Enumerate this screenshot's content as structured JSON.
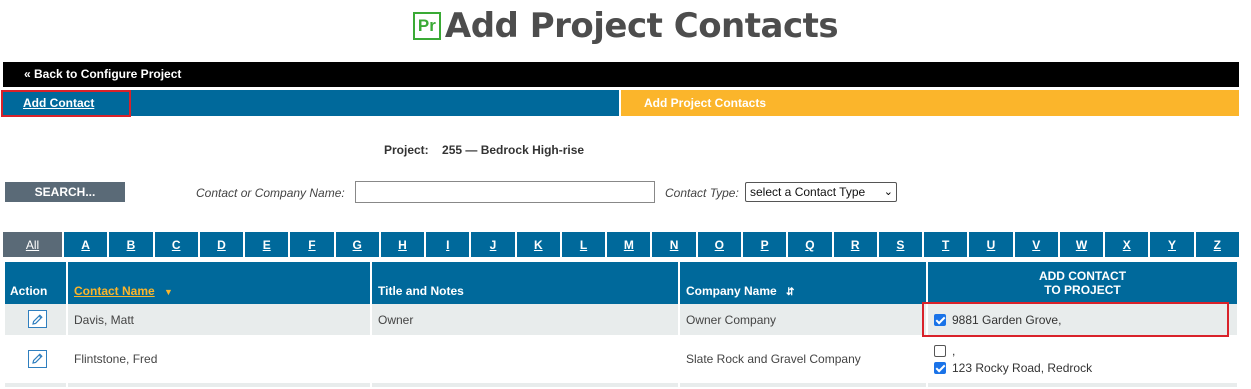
{
  "header": {
    "icon_text": "Pr",
    "title": "Add Project Contacts"
  },
  "nav": {
    "back_link": "« Back to Configure Project"
  },
  "tabs": {
    "add_contact": "Add Contact",
    "add_project_contacts": "Add Project Contacts"
  },
  "project": {
    "label": "Project:",
    "value": "255 — Bedrock High-rise"
  },
  "search": {
    "button_label": "SEARCH...",
    "name_label": "Contact or Company Name:",
    "name_value": "",
    "type_label": "Contact Type:",
    "type_selected": "select a Contact Type"
  },
  "alphabet": [
    "All",
    "A",
    "B",
    "C",
    "D",
    "E",
    "F",
    "G",
    "H",
    "I",
    "J",
    "K",
    "L",
    "M",
    "N",
    "O",
    "P",
    "Q",
    "R",
    "S",
    "T",
    "U",
    "V",
    "W",
    "X",
    "Y",
    "Z"
  ],
  "table": {
    "headers": {
      "action": "Action",
      "contact_name": "Contact Name",
      "title_notes": "Title and Notes",
      "company_name": "Company Name",
      "add_line1": "ADD CONTACT",
      "add_line2": "TO PROJECT"
    },
    "rows": [
      {
        "contact_name": "Davis, Matt",
        "title_notes": "Owner",
        "company_name": "Owner Company",
        "addresses": [
          {
            "text": "9881 Garden Grove,",
            "checked": true
          }
        ]
      },
      {
        "contact_name": "Flintstone, Fred",
        "title_notes": "",
        "company_name": "Slate Rock and Gravel Company",
        "addresses": [
          {
            "text": ",",
            "checked": false
          },
          {
            "text": "123 Rocky Road, Redrock",
            "checked": true
          }
        ]
      }
    ]
  },
  "colors": {
    "primary_blue": "#00699b",
    "accent_orange": "#fbb52b",
    "highlight_red": "#d9222a",
    "brand_green": "#3aaa35"
  },
  "icons": {
    "edit": "pencil-icon",
    "sort": "sort-icon",
    "sort_desc": "caret-down-icon"
  }
}
